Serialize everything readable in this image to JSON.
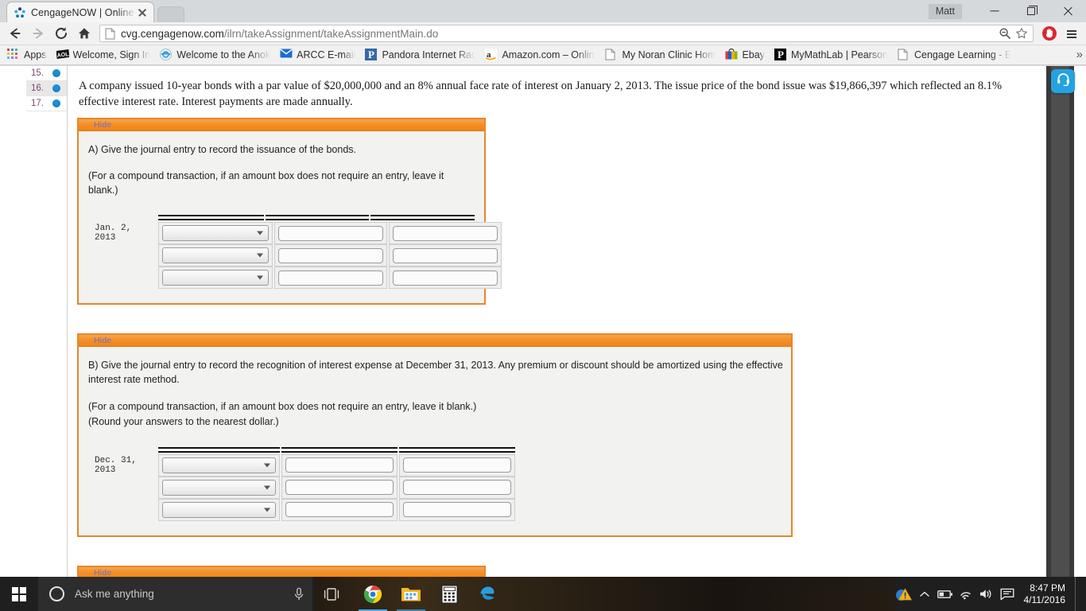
{
  "window": {
    "profile_label": "Matt",
    "minimize_label": "Minimize",
    "maximize_label": "Restore",
    "close_label": "Close"
  },
  "tab": {
    "title": "CengageNOW | Online tea",
    "favicon": "cengage-favicon",
    "close_label": "Close tab",
    "new_tab_label": "New tab"
  },
  "toolbar": {
    "back_label": "Back",
    "forward_label": "Forward",
    "reload_label": "Reload",
    "home_label": "Home",
    "url_main": "cvg.cengagenow.com",
    "url_path": "/ilrn/takeAssignment/takeAssignmentMain.do",
    "zoom_out_label": "Zoom out",
    "bookmark_star_label": "Bookmark this page",
    "adblock_label": "AdBlock",
    "menu_label": "Customize and control Google Chrome"
  },
  "bookmarks": {
    "apps_label": "Apps",
    "overflow_label": "More bookmarks",
    "items": [
      {
        "label": "Welcome, Sign In",
        "icon": "aol-icon"
      },
      {
        "label": "Welcome to the Anok",
        "icon": "globe-icon"
      },
      {
        "label": "ARCC E-mail",
        "icon": "mail-icon"
      },
      {
        "label": "Pandora Internet Radi",
        "icon": "pandora-icon"
      },
      {
        "label": "Amazon.com – Online",
        "icon": "amazon-icon"
      },
      {
        "label": "My Noran Clinic Home",
        "icon": "page-icon"
      },
      {
        "label": "Ebay",
        "icon": "ebay-icon"
      },
      {
        "label": "MyMathLab | Pearson",
        "icon": "pearson-icon"
      },
      {
        "label": "Cengage Learning - E",
        "icon": "page-icon"
      }
    ]
  },
  "question_rail": {
    "items": [
      {
        "number": "15.",
        "status": "answered",
        "selected": false
      },
      {
        "number": "16.",
        "status": "answered",
        "selected": true
      },
      {
        "number": "17.",
        "status": "answered",
        "selected": false
      }
    ]
  },
  "problem": {
    "stem": "A company issued 10-year bonds with a par value of $20,000,000 and an 8% annual face rate of interest on January 2, 2013. The issue price of the bond issue was $19,866,397 which reflected an 8.1% effective interest rate. Interest payments are made annually."
  },
  "parts": [
    {
      "id": "part-a",
      "hide_label": "Hide",
      "prompt": "A) Give the journal entry to record the issuance of the bonds.",
      "note": "(For a compound transaction, if an amount box does not require an entry, leave it blank.)",
      "note2": "",
      "date": "Jan. 2, 2013",
      "rows": [
        {
          "account": "",
          "debit": "",
          "credit": ""
        },
        {
          "account": "",
          "debit": "",
          "credit": ""
        },
        {
          "account": "",
          "debit": "",
          "credit": ""
        }
      ]
    },
    {
      "id": "part-b",
      "hide_label": "Hide",
      "prompt": "B) Give the journal entry to record the recognition of interest expense at December 31, 2013. Any premium or discount should be amortized using the effective interest rate method.",
      "note": "(For a compound transaction, if an amount box does not require an entry, leave it blank.)",
      "note2": "(Round your answers to the nearest dollar.)",
      "date": "Dec. 31, 2013",
      "rows": [
        {
          "account": "",
          "debit": "",
          "credit": ""
        },
        {
          "account": "",
          "debit": "",
          "credit": ""
        },
        {
          "account": "",
          "debit": "",
          "credit": ""
        }
      ]
    },
    {
      "id": "part-c",
      "hide_label": "Hide",
      "prompt": "",
      "note": "",
      "note2": "",
      "date": "",
      "rows": []
    }
  ],
  "support": {
    "label": "Live support chat",
    "icon": "headset-icon",
    "color": "#23a3e0"
  },
  "scrollbar": {
    "up_label": "Scroll up",
    "down_label": "Scroll down",
    "thumb_label": "Vertical scroll thumb"
  },
  "taskbar": {
    "start_label": "Start",
    "search_placeholder": "Ask me anything",
    "mic_label": "Speak to Cortana",
    "task_view_label": "Task View",
    "apps": [
      {
        "name": "chrome",
        "label": "Google Chrome",
        "state": "active"
      },
      {
        "name": "file-explorer",
        "label": "File Explorer",
        "state": "open"
      },
      {
        "name": "calculator",
        "label": "Calculator",
        "state": "open"
      },
      {
        "name": "edge",
        "label": "Microsoft Edge",
        "state": "closed"
      }
    ],
    "tray": [
      {
        "name": "action-warning",
        "label": "Action needed"
      },
      {
        "name": "show-hidden",
        "label": "Show hidden icons"
      },
      {
        "name": "battery",
        "label": "Battery"
      },
      {
        "name": "wifi",
        "label": "Network"
      },
      {
        "name": "volume",
        "label": "Volume"
      },
      {
        "name": "notifications",
        "label": "Action Center"
      }
    ],
    "time": "8:47 PM",
    "date": "4/11/2016"
  },
  "colors": {
    "panel_border": "#e8862a",
    "panel_header": "#ee8415",
    "link": "#6f6fc4",
    "dot": "#1b8fd6",
    "accent_blue": "#23a3e0"
  }
}
